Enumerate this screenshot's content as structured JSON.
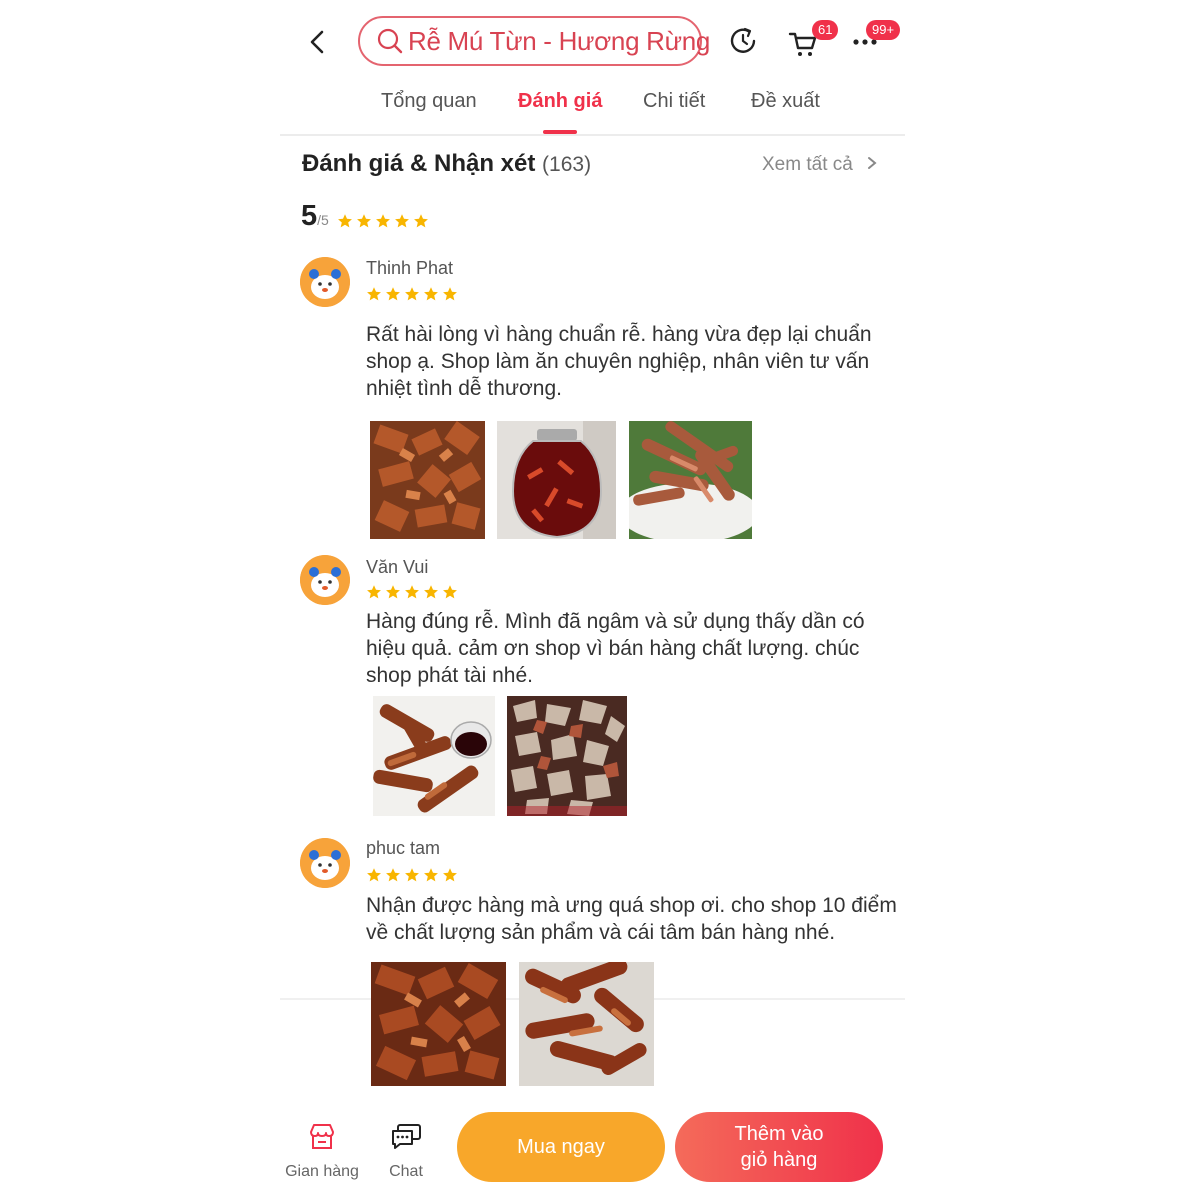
{
  "header": {
    "search_text": "Rễ Mú Từn -  Hương Rừng",
    "cart_badge": "61",
    "more_badge": "99+"
  },
  "tabs": [
    {
      "label": "Tổng quan"
    },
    {
      "label": "Đánh giá"
    },
    {
      "label": "Chi tiết"
    },
    {
      "label": "Đề xuất"
    }
  ],
  "reviews_section": {
    "title": "Đánh giá & Nhận xét",
    "count": "(163)",
    "see_all": "Xem tất cả",
    "score": "5",
    "score_max": "/5",
    "stars": 5
  },
  "reviews": [
    {
      "name": "Thinh Phat",
      "stars": 5,
      "text": "Rất hài lòng vì hàng chuẩn rễ. hàng vừa đẹp lại chuẩn shop ạ. Shop làm ăn chuyên nghiệp, nhân viên tư vấn nhiệt tình dễ thương."
    },
    {
      "name": "Văn Vui",
      "stars": 5,
      "text": "Hàng đúng rễ. Mình đã ngâm và sử dụng thấy dần có hiệu quả. cảm ơn shop vì bán hàng chất lượng. chúc shop phát tài nhé."
    },
    {
      "name": "phuc tam",
      "stars": 5,
      "text": "Nhận được hàng mà ưng quá shop ơi. cho shop 10 điểm về chất lượng sản phẩm và cái tâm bán hàng nhé."
    }
  ],
  "bottom_bar": {
    "shop_label": "Gian hàng",
    "chat_label": "Chat",
    "buy_now": "Mua ngay",
    "add_to_cart_line1": "Thêm vào",
    "add_to_cart_line2": "giỏ hàng"
  },
  "colors": {
    "accent": "#f0314a",
    "star": "#f8b500",
    "buy": "#f8a72a"
  }
}
